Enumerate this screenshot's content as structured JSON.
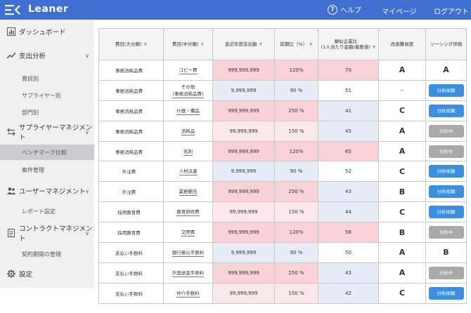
{
  "header": {
    "app_name": "Leaner",
    "help_label": "ヘルプ",
    "mypage_label": "マイページ",
    "logout_label": "ログアウト",
    "brand_color": "#3f6fd1"
  },
  "sidebar": {
    "items": [
      {
        "label": "ダッシュボード",
        "icon": "bar-chart-icon"
      },
      {
        "label": "支出分析",
        "icon": "line-chart-icon"
      },
      {
        "label": "費目別"
      },
      {
        "label": "サプライヤー別"
      },
      {
        "label": "部門別"
      },
      {
        "label": "サプライヤーマネジメント",
        "icon": "swap-icon"
      },
      {
        "label": "ベンチマーク比較"
      },
      {
        "label": "案件管理"
      },
      {
        "label": "ユーザーマネジメント",
        "icon": "users-icon"
      },
      {
        "label": "レポート設定"
      },
      {
        "label": "コントラクトマネジメント",
        "icon": "document-icon"
      },
      {
        "label": "契約期間の管理"
      },
      {
        "label": "設定",
        "icon": "gear-icon"
      }
    ]
  },
  "table": {
    "headers": [
      "費目(大分類)",
      "費目(中分類)",
      "直近年度支出額",
      "前期比（%）",
      "類似企業比\n(1人当たり金額/偏差値)",
      "改善難易度",
      "ソーシング評価"
    ],
    "rows": [
      {
        "cat": "事務消耗品費",
        "sub": "コピー費",
        "amount": "999,999,999",
        "ratio": "120%",
        "bench": "70",
        "grade": "A",
        "eval": "A",
        "eval_type": "text"
      },
      {
        "cat": "事務消耗品費",
        "sub": "その他\n(事務消耗品費)",
        "amount": "9,999,999",
        "ratio": "90 %",
        "bench": "51",
        "grade": "–",
        "eval": "分析依頼",
        "eval_type": "blue"
      },
      {
        "cat": "事務消耗品費",
        "sub": "什器・備品",
        "amount": "999,999,999",
        "ratio": "250 %",
        "bench": "41",
        "grade": "C",
        "eval": "分析依頼",
        "eval_type": "blue"
      },
      {
        "cat": "事務消耗品費",
        "sub": "消耗品",
        "amount": "99,999,999",
        "ratio": "150 %",
        "bench": "45",
        "grade": "A",
        "eval": "分析中",
        "eval_type": "gray"
      },
      {
        "cat": "事務消耗品費",
        "sub": "名刺",
        "amount": "999,999,999",
        "ratio": "120%",
        "bench": "65",
        "grade": "A",
        "eval": "分析中",
        "eval_type": "gray"
      },
      {
        "cat": "外注費",
        "sub": "人材派遣",
        "amount": "9,999,999",
        "ratio": "90 %",
        "bench": "52",
        "grade": "C",
        "eval": "分析依頼",
        "eval_type": "blue"
      },
      {
        "cat": "外注費",
        "sub": "業務委託",
        "amount": "999,999,999",
        "ratio": "250 %",
        "bench": "43",
        "grade": "B",
        "eval": "分析依頼",
        "eval_type": "blue"
      },
      {
        "cat": "採用教育費",
        "sub": "教育研修費",
        "amount": "99,999,999",
        "ratio": "150 %",
        "bench": "44",
        "grade": "C",
        "eval": "分析依頼",
        "eval_type": "blue"
      },
      {
        "cat": "採用教育費",
        "sub": "交際費",
        "amount": "999,999,999",
        "ratio": "120%",
        "bench": "58",
        "grade": "B",
        "eval": "分析中",
        "eval_type": "gray"
      },
      {
        "cat": "支払い手数料",
        "sub": "銀行振込手数料",
        "amount": "9,999,999",
        "ratio": "90 %",
        "bench": "50",
        "grade": "A",
        "eval": "B",
        "eval_type": "text"
      },
      {
        "cat": "支払い手数料",
        "sub": "外国送金手数料",
        "amount": "999,999,999",
        "ratio": "250 %",
        "bench": "43",
        "grade": "A",
        "eval": "分析中",
        "eval_type": "gray"
      },
      {
        "cat": "支払い手数料",
        "sub": "仲介手数料",
        "amount": "99,999,999",
        "ratio": "150 %",
        "bench": "42",
        "grade": "C",
        "eval": "分析依頼",
        "eval_type": "blue"
      }
    ]
  }
}
